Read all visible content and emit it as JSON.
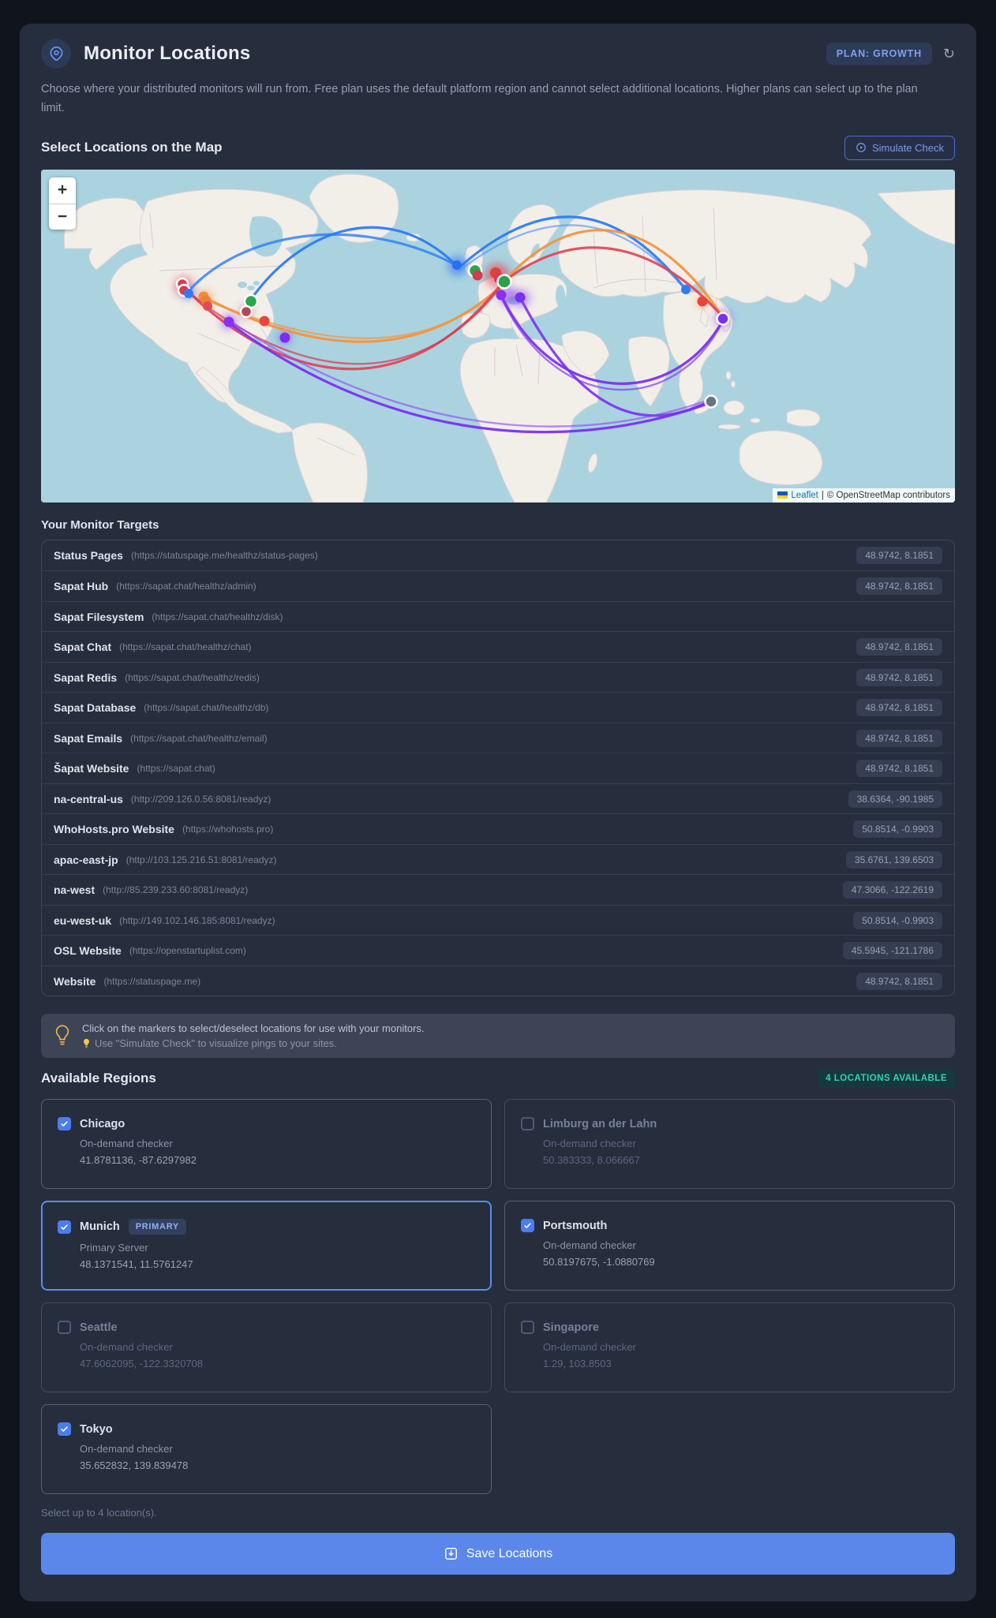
{
  "header": {
    "title": "Monitor Locations",
    "plan_badge": "PLAN: GROWTH",
    "description": "Choose where your distributed monitors will run from. Free plan uses the default platform region and cannot select additional locations. Higher plans can select up to the plan limit."
  },
  "map_section": {
    "heading": "Select Locations on the Map",
    "simulate_button": "Simulate Check",
    "zoom_in": "+",
    "zoom_out": "−",
    "attribution_leaflet": "Leaflet",
    "attribution_sep": "|",
    "attribution_osm": "© OpenStreetMap contributors"
  },
  "targets": {
    "heading": "Your Monitor Targets",
    "rows": [
      {
        "name": "Status Pages",
        "url": "(https://statuspage.me/healthz/status-pages)",
        "coords": "48.9742, 8.1851"
      },
      {
        "name": "Sapat Hub",
        "url": "(https://sapat.chat/healthz/admin)",
        "coords": "48.9742, 8.1851"
      },
      {
        "name": "Sapat Filesystem",
        "url": "(https://sapat.chat/healthz/disk)",
        "coords": ""
      },
      {
        "name": "Sapat Chat",
        "url": "(https://sapat.chat/healthz/chat)",
        "coords": "48.9742, 8.1851"
      },
      {
        "name": "Sapat Redis",
        "url": "(https://sapat.chat/healthz/redis)",
        "coords": "48.9742, 8.1851"
      },
      {
        "name": "Sapat Database",
        "url": "(https://sapat.chat/healthz/db)",
        "coords": "48.9742, 8.1851"
      },
      {
        "name": "Sapat Emails",
        "url": "(https://sapat.chat/healthz/email)",
        "coords": "48.9742, 8.1851"
      },
      {
        "name": "Šapat Website",
        "url": "(https://sapat.chat)",
        "coords": "48.9742, 8.1851"
      },
      {
        "name": "na-central-us",
        "url": "(http://209.126.0.56:8081/readyz)",
        "coords": "38.6364, -90.1985"
      },
      {
        "name": "WhoHosts.pro Website",
        "url": "(https://whohosts.pro)",
        "coords": "50.8514, -0.9903"
      },
      {
        "name": "apac-east-jp",
        "url": "(http://103.125.216.51:8081/readyz)",
        "coords": "35.6761, 139.6503"
      },
      {
        "name": "na-west",
        "url": "(http://85.239.233.60:8081/readyz)",
        "coords": "47.3066, -122.2619"
      },
      {
        "name": "eu-west-uk",
        "url": "(http://149.102.146.185:8081/readyz)",
        "coords": "50.8514, -0.9903"
      },
      {
        "name": "OSL Website",
        "url": "(https://openstartuplist.com)",
        "coords": "45.5945, -121.1786"
      },
      {
        "name": "Website",
        "url": "(https://statuspage.me)",
        "coords": "48.9742, 8.1851"
      }
    ]
  },
  "tip": {
    "line1": "Click on the markers to select/deselect locations for use with your monitors.",
    "line2": "Use \"Simulate Check\" to visualize pings to your sites.",
    "icon": "lightbulb"
  },
  "regions": {
    "heading": "Available Regions",
    "availability_badge": "4 LOCATIONS AVAILABLE",
    "cards": [
      {
        "name": "Chicago",
        "sub": "On-demand checker",
        "coords": "41.8781136, -87.6297982",
        "checked": true
      },
      {
        "name": "Limburg an der Lahn",
        "sub": "On-demand checker",
        "coords": "50.383333, 8.066667",
        "checked": false
      },
      {
        "name": "Munich",
        "badge": "PRIMARY",
        "sub": "Primary Server",
        "coords": "48.1371541, 11.5761247",
        "checked": true
      },
      {
        "name": "Portsmouth",
        "sub": "On-demand checker",
        "coords": "50.8197675, -1.0880769",
        "checked": true
      },
      {
        "name": "Seattle",
        "sub": "On-demand checker",
        "coords": "47.6062095, -122.3320708",
        "checked": false
      },
      {
        "name": "Singapore",
        "sub": "On-demand checker",
        "coords": "1.29, 103.8503",
        "checked": false
      },
      {
        "name": "Tokyo",
        "sub": "On-demand checker",
        "coords": "35.652832, 139.839478",
        "checked": true
      }
    ],
    "footnote": "Select up to 4 location(s)."
  },
  "save": {
    "label": "Save Locations"
  },
  "colors": {
    "accent_blue": "#5b87ea",
    "checkbox_blue": "#4b7cf0",
    "plan_text": "#7f9ff2",
    "teal_badge": "#2fd5b2",
    "map_water": "#aad3df",
    "map_land": "#f2efe9",
    "arc_blue": "#2b7cf7",
    "arc_orange": "#f5943d",
    "arc_red": "#e0485a",
    "arc_purple": "#7b2ff2"
  }
}
